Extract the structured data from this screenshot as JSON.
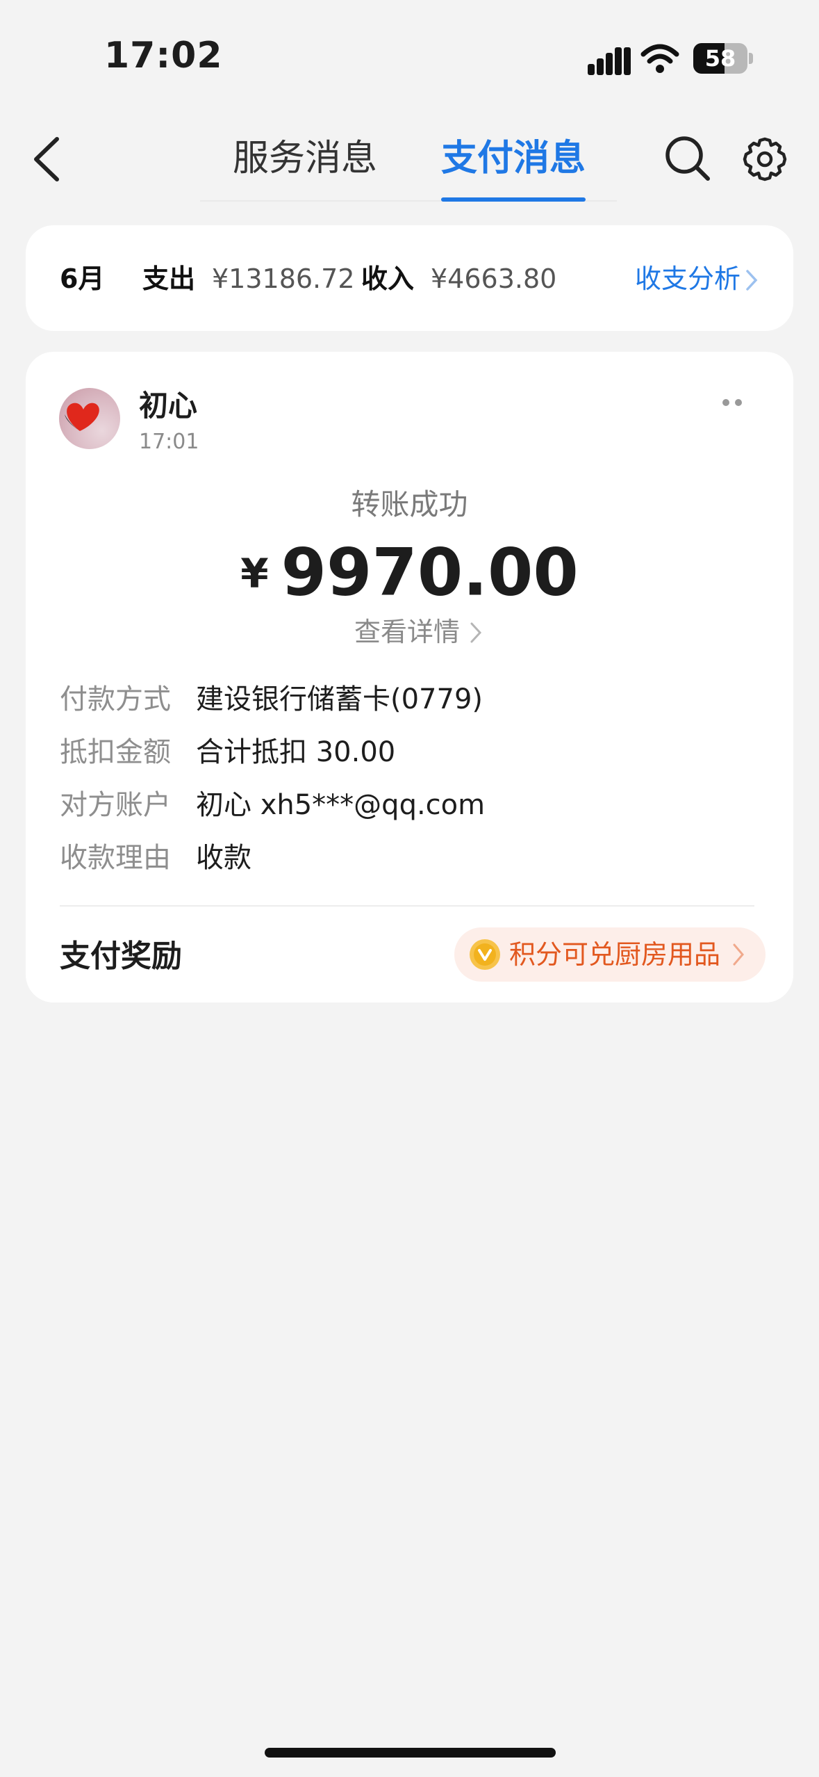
{
  "status_bar": {
    "time": "17:02",
    "battery": "58",
    "battery_level": 0.58
  },
  "nav": {
    "tabs": [
      {
        "label": "服务消息",
        "active": false
      },
      {
        "label": "支付消息",
        "active": true
      }
    ],
    "icons": [
      "back-arrow-icon",
      "search-icon",
      "gear-icon"
    ]
  },
  "summary": {
    "month": "6月",
    "expense_label": "支出",
    "expense_value": "¥13186.72",
    "income_label": "收入",
    "income_value": "¥4663.80",
    "analysis_link": "收支分析"
  },
  "message": {
    "sender": "初心",
    "time": "17:01",
    "status": "转账成功",
    "currency": "¥",
    "amount": "9970.00",
    "detail_link": "查看详情",
    "rows": [
      {
        "label": "付款方式",
        "value": "建设银行储蓄卡(0779)"
      },
      {
        "label": "抵扣金额",
        "value": "合计抵扣 30.00"
      },
      {
        "label": "对方账户",
        "value": "初心 xh5***@qq.com"
      },
      {
        "label": "收款理由",
        "value": "收款"
      }
    ],
    "reward_label": "支付奖励",
    "reward_pill": "积分可兑厨房用品"
  },
  "colors": {
    "accent": "#1f78e5",
    "reward_orange": "#e2581f",
    "reward_bg": "#fdeee9",
    "background": "#f3f3f3"
  }
}
